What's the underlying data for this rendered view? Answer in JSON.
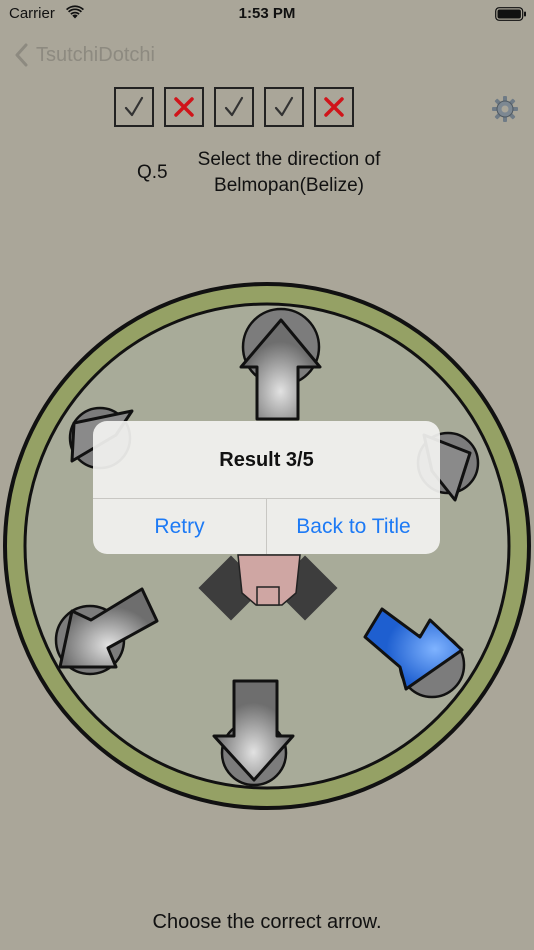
{
  "status_bar": {
    "carrier": "Carrier",
    "time": "1:53 PM"
  },
  "nav": {
    "back_label": "TsutchiDotchi"
  },
  "score": [
    "correct",
    "wrong",
    "correct",
    "correct",
    "wrong"
  ],
  "question": {
    "number": "Q.5",
    "text": "Select the direction of Belmopan(Belize)"
  },
  "dialog": {
    "title": "Result 3/5",
    "retry_label": "Retry",
    "back_label": "Back to Title"
  },
  "footer": {
    "instruction": "Choose the correct arrow."
  },
  "colors": {
    "background": "#aaa699",
    "ring": "#95a165",
    "dial": "#a8ab99",
    "arrow": "#7a7a7a",
    "selected_arrow": "#1e5fd0",
    "wrong_mark": "#d0141a",
    "link": "#1d7af5"
  },
  "icons": {
    "back": "chevron-left-icon",
    "settings": "gear-icon",
    "correct": "checkmark-icon",
    "wrong": "x-mark-icon"
  }
}
